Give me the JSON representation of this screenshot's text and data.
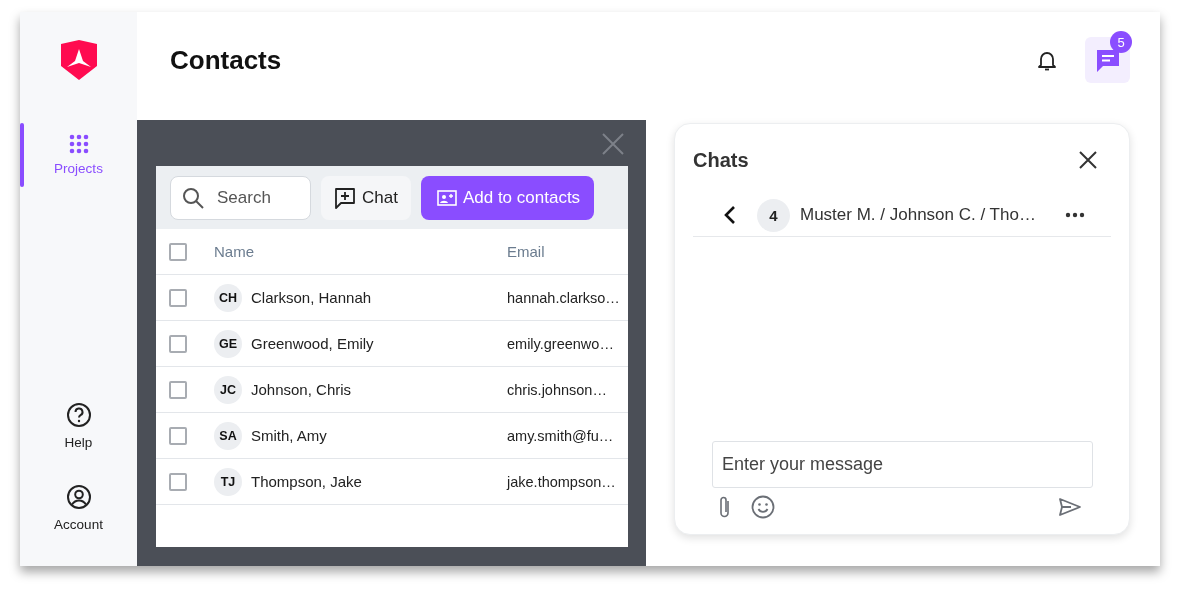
{
  "sidebar": {
    "top_items": [
      {
        "label": "Projects",
        "selected": true
      }
    ],
    "bottom_items": [
      {
        "label": "Help",
        "selected": false
      },
      {
        "label": "Account",
        "selected": false
      }
    ]
  },
  "header": {
    "title": "Contacts",
    "chat_badge": "5"
  },
  "contacts_dialog": {
    "search": {
      "placeholder": "Search"
    },
    "buttons": [
      {
        "label": "Chat",
        "kind": "secondary"
      },
      {
        "label": "Add to contacts",
        "kind": "primary"
      }
    ],
    "select_all": {
      "checked": false
    },
    "columns": [
      "Name",
      "Email"
    ],
    "rows": [
      {
        "initials": "CH",
        "name": "Clarkson, Hannah",
        "email": "hannah.clarkso…",
        "checked": false
      },
      {
        "initials": "GE",
        "name": "Greenwood, Emily",
        "email": "emily.greenwo…",
        "checked": false
      },
      {
        "initials": "JC",
        "name": "Johnson, Chris",
        "email": "chris.johnson…",
        "checked": false
      },
      {
        "initials": "SA",
        "name": "Smith, Amy",
        "email": "amy.smith@fu…",
        "checked": false
      },
      {
        "initials": "TJ",
        "name": "Thompson, Jake",
        "email": "jake.thompson…",
        "checked": false
      }
    ]
  },
  "chats": {
    "title": "Chats",
    "conversation": {
      "count": "4",
      "title": "Muster M. / Johnson C. / Tho…"
    },
    "message": {
      "placeholder": "Enter your message"
    }
  }
}
